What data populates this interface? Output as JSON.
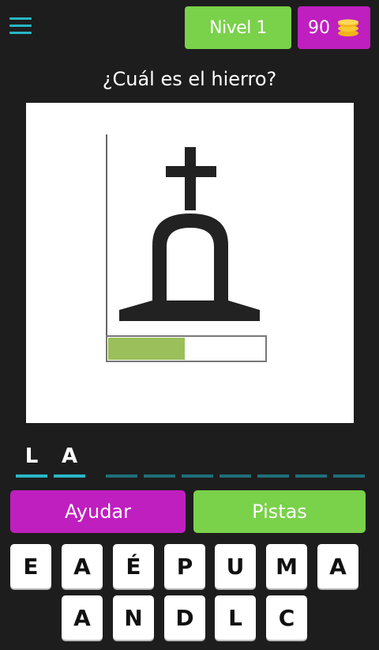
{
  "header": {
    "level_label": "Nivel 1",
    "coins": "90",
    "coin_icon": "coins-icon",
    "menu_icon": "hamburger-menu-icon"
  },
  "question": "¿Cuál es el hierro?",
  "answer_slots": [
    {
      "letter": "L"
    },
    {
      "letter": "A"
    },
    {
      "letter": ""
    },
    {
      "letter": ""
    },
    {
      "letter": ""
    },
    {
      "letter": ""
    },
    {
      "letter": ""
    },
    {
      "letter": ""
    },
    {
      "letter": ""
    }
  ],
  "actions": {
    "help_label": "Ayudar",
    "hints_label": "Pistas"
  },
  "keyboard": {
    "row1": [
      "E",
      "A",
      "É",
      "P",
      "U",
      "M",
      "A"
    ],
    "row2": [
      "A",
      "N",
      "D",
      "L",
      "C"
    ]
  },
  "image": {
    "description_icon": "bell-with-cross-brand-icon",
    "level_bar_fraction": 0.49
  },
  "colors": {
    "background": "#1d1d1d",
    "green": "#7ad14a",
    "purple": "#bf1fbf",
    "teal": "#29b6c6"
  }
}
